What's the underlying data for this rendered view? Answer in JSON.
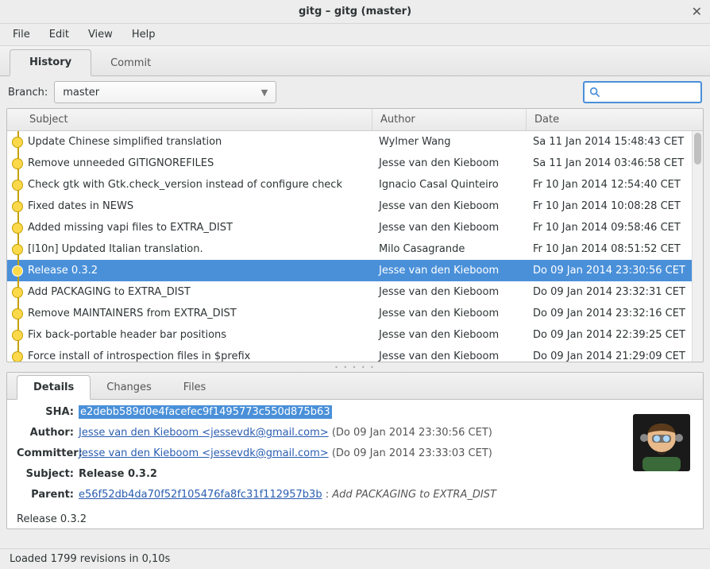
{
  "window": {
    "title": "gitg – gitg (master)"
  },
  "menubar": {
    "items": [
      "File",
      "Edit",
      "View",
      "Help"
    ]
  },
  "top_tabs": {
    "tabs": [
      "History",
      "Commit"
    ],
    "active": 0
  },
  "branch": {
    "label": "Branch:",
    "value": "master"
  },
  "search": {
    "placeholder": ""
  },
  "table": {
    "headers": {
      "subject": "Subject",
      "author": "Author",
      "date": "Date"
    },
    "selected_index": 6,
    "rows": [
      {
        "subject": "Update Chinese simplified translation",
        "author": "Wylmer Wang",
        "date": "Sa 11 Jan 2014 15:48:43 CET"
      },
      {
        "subject": "Remove unneeded GITIGNOREFILES",
        "author": "Jesse van den Kieboom",
        "date": "Sa 11 Jan 2014 03:46:58 CET"
      },
      {
        "subject": "Check gtk with Gtk.check_version instead of configure check",
        "author": "Ignacio Casal Quinteiro",
        "date": "Fr 10 Jan 2014 12:54:40 CET"
      },
      {
        "subject": "Fixed dates in NEWS",
        "author": "Jesse van den Kieboom",
        "date": "Fr 10 Jan 2014 10:08:28 CET"
      },
      {
        "subject": "Added missing vapi files to EXTRA_DIST",
        "author": "Jesse van den Kieboom",
        "date": "Fr 10 Jan 2014 09:58:46 CET"
      },
      {
        "subject": "[l10n] Updated Italian translation.",
        "author": "Milo Casagrande",
        "date": "Fr 10 Jan 2014 08:51:52 CET"
      },
      {
        "subject": "Release 0.3.2",
        "author": "Jesse van den Kieboom",
        "date": "Do 09 Jan 2014 23:30:56 CET"
      },
      {
        "subject": "Add PACKAGING to EXTRA_DIST",
        "author": "Jesse van den Kieboom",
        "date": "Do 09 Jan 2014 23:32:31 CET"
      },
      {
        "subject": "Remove MAINTAINERS from EXTRA_DIST",
        "author": "Jesse van den Kieboom",
        "date": "Do 09 Jan 2014 23:32:16 CET"
      },
      {
        "subject": "Fix back-portable header bar positions",
        "author": "Jesse van den Kieboom",
        "date": "Do 09 Jan 2014 22:39:25 CET"
      },
      {
        "subject": "Force install of introspection files in $prefix",
        "author": "Jesse van den Kieboom",
        "date": "Do 09 Jan 2014 21:29:09 CET"
      }
    ]
  },
  "detail_tabs": {
    "tabs": [
      "Details",
      "Changes",
      "Files"
    ],
    "active": 0
  },
  "details": {
    "labels": {
      "sha": "SHA:",
      "author": "Author:",
      "committer": "Committer:",
      "subject": "Subject:",
      "parent": "Parent:"
    },
    "sha": "e2debb589d0e4facefec9f1495773c550d875b63",
    "author_link": "Jesse van den Kieboom <jessevdk@gmail.com>",
    "author_date": "(Do 09 Jan 2014 23:30:56 CET)",
    "committer_link": "Jesse van den Kieboom <jessevdk@gmail.com>",
    "committer_date": "(Do 09 Jan 2014 23:33:03 CET)",
    "subject": "Release 0.3.2",
    "parent_sha": "e56f52db4da70f52f105476fa8fc31f112957b3b",
    "parent_subject": "Add PACKAGING to EXTRA_DIST",
    "tag": "Release 0.3.2"
  },
  "statusbar": {
    "text": "Loaded 1799 revisions in 0,10s"
  }
}
